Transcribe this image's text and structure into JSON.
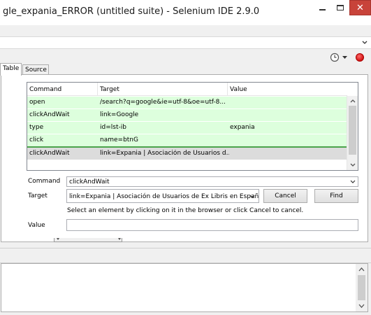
{
  "window": {
    "title": "gle_expania_ERROR (untitled suite) - Selenium IDE 2.9.0",
    "close_glyph": "✕"
  },
  "toolbar": {
    "icons": [
      "clock-icon",
      "dropdown-icon",
      "record-icon"
    ],
    "record_color": "#d11414"
  },
  "tabs": [
    {
      "label": "Table",
      "active": true
    },
    {
      "label": "Source",
      "active": false
    }
  ],
  "table": {
    "headers": [
      "Command",
      "Target",
      "Value"
    ],
    "rows": [
      {
        "command": "open",
        "target": "/search?q=google&ie=utf-8&oe=utf-8...",
        "value": "",
        "state": "passed"
      },
      {
        "command": "clickAndWait",
        "target": "link=Google",
        "value": "",
        "state": "passed"
      },
      {
        "command": "type",
        "target": "id=lst-ib",
        "value": "expania",
        "state": "passed"
      },
      {
        "command": "click",
        "target": "name=btnG",
        "value": "",
        "state": "passed"
      },
      {
        "command": "clickAndWait",
        "target": "link=Expania | Asociación de Usuarios d...",
        "value": "",
        "state": "selected"
      }
    ],
    "passed_color": "#ddffdd",
    "selected_color": "#dcdcdc"
  },
  "form": {
    "command_label": "Command",
    "command_value": "clickAndWait",
    "target_label": "Target",
    "target_value": "link=Expania | Asociación de Usuarios de Ex Libris en Españ",
    "cancel_label": "Cancel",
    "find_label": "Find",
    "hint": "Select an element by clicking on it in the browser or click Cancel to cancel.",
    "value_label": "Value",
    "value_value": ""
  }
}
